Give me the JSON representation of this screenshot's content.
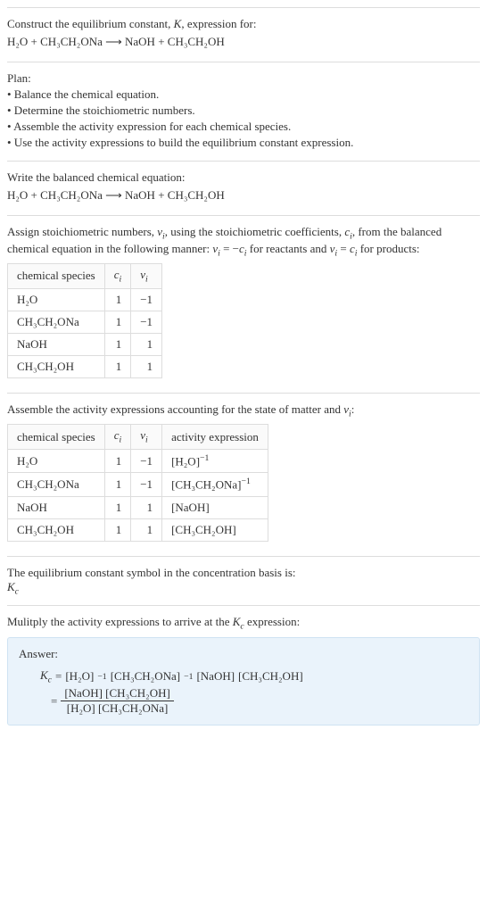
{
  "intro": {
    "line1": "Construct the equilibrium constant, K, expression for:",
    "equation": "H₂O + CH₃CH₂ONa ⟶ NaOH + CH₃CH₂OH"
  },
  "plan": {
    "title": "Plan:",
    "items": [
      "• Balance the chemical equation.",
      "• Determine the stoichiometric numbers.",
      "• Assemble the activity expression for each chemical species.",
      "• Use the activity expressions to build the equilibrium constant expression."
    ]
  },
  "balanced": {
    "title": "Write the balanced chemical equation:",
    "equation": "H₂O + CH₃CH₂ONa ⟶ NaOH + CH₃CH₂OH"
  },
  "stoich": {
    "intro": "Assign stoichiometric numbers, νᵢ, using the stoichiometric coefficients, cᵢ, from the balanced chemical equation in the following manner: νᵢ = −cᵢ for reactants and νᵢ = cᵢ for products:",
    "headers": [
      "chemical species",
      "cᵢ",
      "νᵢ"
    ],
    "rows": [
      [
        "H₂O",
        "1",
        "−1"
      ],
      [
        "CH₃CH₂ONa",
        "1",
        "−1"
      ],
      [
        "NaOH",
        "1",
        "1"
      ],
      [
        "CH₃CH₂OH",
        "1",
        "1"
      ]
    ]
  },
  "activity": {
    "intro": "Assemble the activity expressions accounting for the state of matter and νᵢ:",
    "headers": [
      "chemical species",
      "cᵢ",
      "νᵢ",
      "activity expression"
    ],
    "rows": [
      {
        "sp": "H₂O",
        "c": "1",
        "v": "−1",
        "act_base": "[H₂O]",
        "act_exp": "−1"
      },
      {
        "sp": "CH₃CH₂ONa",
        "c": "1",
        "v": "−1",
        "act_base": "[CH₃CH₂ONa]",
        "act_exp": "−1"
      },
      {
        "sp": "NaOH",
        "c": "1",
        "v": "1",
        "act_base": "[NaOH]",
        "act_exp": ""
      },
      {
        "sp": "CH₃CH₂OH",
        "c": "1",
        "v": "1",
        "act_base": "[CH₃CH₂OH]",
        "act_exp": ""
      }
    ]
  },
  "symbol": {
    "line1": "The equilibrium constant symbol in the concentration basis is:",
    "sym": "K𝒸"
  },
  "multiply": {
    "line": "Mulitply the activity expressions to arrive at the K𝒸 expression:"
  },
  "answer": {
    "label": "Answer:",
    "kc": "K𝒸 = ",
    "prod_terms": [
      {
        "base": "[H₂O]",
        "exp": "−1"
      },
      {
        "base": "[CH₃CH₂ONa]",
        "exp": "−1"
      },
      {
        "base": "[NaOH]",
        "exp": ""
      },
      {
        "base": "[CH₃CH₂OH]",
        "exp": ""
      }
    ],
    "eq_sign": " = ",
    "frac_num": "[NaOH] [CH₃CH₂OH]",
    "frac_den": "[H₂O] [CH₃CH₂ONa]"
  },
  "chart_data": {
    "type": "table",
    "tables": [
      {
        "title": "stoichiometric numbers",
        "columns": [
          "chemical species",
          "c_i",
          "ν_i"
        ],
        "rows": [
          [
            "H2O",
            1,
            -1
          ],
          [
            "CH3CH2ONa",
            1,
            -1
          ],
          [
            "NaOH",
            1,
            1
          ],
          [
            "CH3CH2OH",
            1,
            1
          ]
        ]
      },
      {
        "title": "activity expressions",
        "columns": [
          "chemical species",
          "c_i",
          "ν_i",
          "activity expression"
        ],
        "rows": [
          [
            "H2O",
            1,
            -1,
            "[H2O]^-1"
          ],
          [
            "CH3CH2ONa",
            1,
            -1,
            "[CH3CH2ONa]^-1"
          ],
          [
            "NaOH",
            1,
            1,
            "[NaOH]"
          ],
          [
            "CH3CH2OH",
            1,
            1,
            "[CH3CH2OH]"
          ]
        ]
      }
    ]
  }
}
